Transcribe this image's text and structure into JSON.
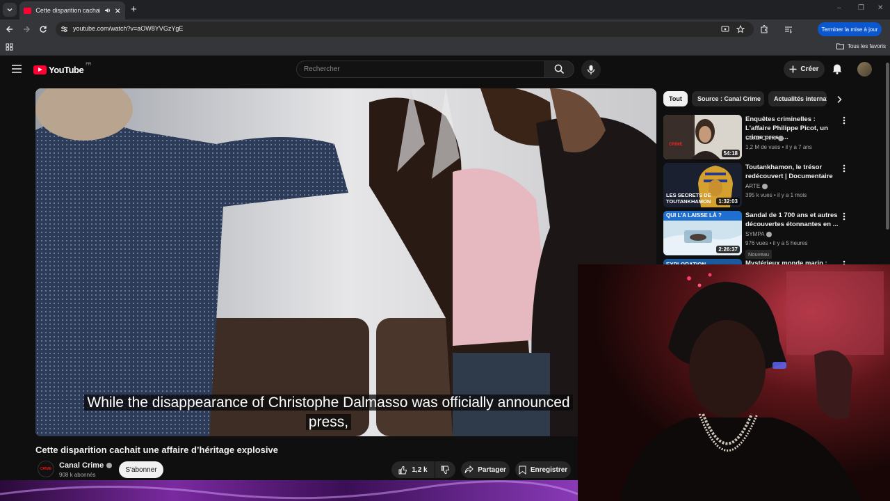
{
  "browser": {
    "tab_title": "Cette disparition cachait une affaire d'héritage explosive",
    "url": "youtube.com/watch?v=aOW8YVGzYgE",
    "update_label": "Terminer la mise à jour",
    "bookmarks_all": "Tous les favoris"
  },
  "youtube": {
    "logo_text": "YouTube",
    "country_code": "FR",
    "search_placeholder": "Rechercher",
    "create_label": "Créer",
    "accent_color": "#ff0033"
  },
  "video": {
    "caption_line1": "While the disappearance of Christophe Dalmasso was officially announced",
    "caption_line2": "press,",
    "title": "Cette disparition cachait une affaire d’héritage explosive",
    "channel": {
      "name": "Canal Crime",
      "subscribers": "908 k abonnés",
      "avatar_text": "CRIME"
    },
    "subscribe_label": "S'abonner",
    "like_count": "1,2 k",
    "share_label": "Partager",
    "save_label": "Enregistrer"
  },
  "sidebar": {
    "chips": [
      {
        "label": "Tout",
        "active": true
      },
      {
        "label": "Source : Canal Crime",
        "active": false
      },
      {
        "label": "Actualités internationales",
        "active": false
      }
    ],
    "recommendations": [
      {
        "title": "Enquêtes criminelles : L'affaire Philippe Picot, un crime presq...",
        "channel": "Canal Crime",
        "meta": "1,2 M de vues • il y a 7 ans",
        "duration": "54:18",
        "thumb_text": "CRIME"
      },
      {
        "title": "Toutankhamon, le trésor redécouvert | Documentaire ...",
        "channel": "ARTE",
        "meta": "395 k vues • il y a 1 mois",
        "duration": "1:32:03",
        "thumb_text": "LES SECRETS DE TOUTANKHAMON"
      },
      {
        "title": "Sandal de 1 700 ans et autres découvertes étonnantes en ...",
        "channel": "SYMPA",
        "meta": "976 vues • il y a 5 heures",
        "duration": "2:26:37",
        "thumb_text": "QUI L'A LAISSE LÀ ?",
        "badge": "Nouveau"
      },
      {
        "title": "Mystérieux monde marin :",
        "thumb_text": "EXPLORATION"
      }
    ]
  }
}
